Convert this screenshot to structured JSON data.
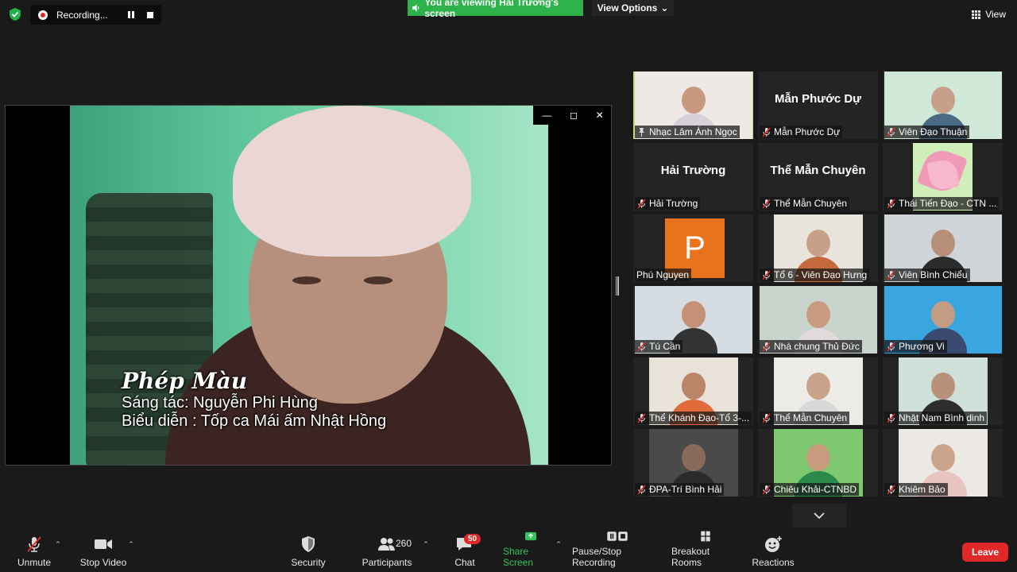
{
  "top": {
    "recording_label": "Recording...",
    "viewing_banner": "You are viewing Hải Trường's screen",
    "view_options": "View Options",
    "view_label": "View"
  },
  "video": {
    "caption_title": "Phép Màu",
    "caption_composer": "Sáng tác:   Nguyễn Phi Hùng",
    "caption_performer": "Biểu diễn : Tốp ca Mái ấm Nhật Hồng"
  },
  "participants": [
    {
      "label": "Nhạc Lâm Ánh Ngọc",
      "mode": "video",
      "active": true,
      "skin": "#c79a80",
      "shirt": "#d8d0d8",
      "bg": "#efe9e6",
      "pinned": true
    },
    {
      "label": "Mẫn Phước Dự",
      "mode": "name",
      "name": "Mẫn Phước Dự"
    },
    {
      "label": "Viên Đạo Thuận",
      "mode": "video",
      "skin": "#c7a08a",
      "shirt": "#4a6a86",
      "bg": "#cfe8d8"
    },
    {
      "label": "Hải Trường",
      "mode": "name",
      "name": "Hải Trường"
    },
    {
      "label": "Thể Mẫn Chuyên",
      "mode": "name",
      "name": "Thể Mẫn Chuyên"
    },
    {
      "label": "Thái Tiến Đạo - CTN ...",
      "mode": "flower"
    },
    {
      "label": "Phú Nguyen",
      "mode": "avatar",
      "letter": "P",
      "nomic": true
    },
    {
      "label": "Tổ 6  - Viên Đạo Hưng",
      "mode": "video",
      "skin": "#c8a08a",
      "shirt": "#c46a3c",
      "bg": "#e9e4dc"
    },
    {
      "label": "Viên Bình Chiểu",
      "mode": "video",
      "skin": "#b78e78",
      "shirt": "#2b2b2b",
      "bg": "#cfd4d8"
    },
    {
      "label": "Tú Cần",
      "mode": "video",
      "skin": "#c49076",
      "shirt": "#333333",
      "bg": "#d5dde3"
    },
    {
      "label": "Nhà chung Thủ Đức",
      "mode": "video",
      "skin": "#c89a82",
      "shirt": "#e0dada",
      "bg": "#c8d4cc"
    },
    {
      "label": "Phương Vi",
      "mode": "video",
      "skin": "#c49c84",
      "shirt": "#3a4a70",
      "bg": "#3aa6e0"
    },
    {
      "label": "Thể Khánh Đạo-Tổ 3-...",
      "mode": "video",
      "skin": "#b98468",
      "shirt": "#e06a3a",
      "bg": "#e8e2d8"
    },
    {
      "label": "Thể Mẫn Chuyên",
      "mode": "video",
      "skin": "#caa28a",
      "shirt": "#d8d8d8",
      "bg": "#ecebe6"
    },
    {
      "label": "Nhật Nam Bình dinh",
      "mode": "video",
      "skin": "#b9907a",
      "shirt": "#2e2e2e",
      "bg": "#cfe0d8"
    },
    {
      "label": "ĐPA-Trí Bình Hải",
      "mode": "video",
      "skin": "#8a6a5a",
      "shirt": "#2a2a2a",
      "bg": "#4a4a4a"
    },
    {
      "label": "Chiêu Khải-CTNBD",
      "mode": "video",
      "skin": "#c89a7e",
      "shirt": "#2a8a4a",
      "bg": "#7ec870"
    },
    {
      "label": "Khiêm Bảo",
      "mode": "video",
      "skin": "#cca48c",
      "shirt": "#e8c4c0",
      "bg": "#ece8e4"
    }
  ],
  "toolbar": {
    "unmute": "Unmute",
    "stop_video": "Stop Video",
    "security": "Security",
    "participants": "Participants",
    "participants_count": "260",
    "chat": "Chat",
    "chat_badge": "50",
    "share_screen": "Share Screen",
    "pause_stop": "Pause/Stop Recording",
    "breakout": "Breakout Rooms",
    "reactions": "Reactions",
    "leave": "Leave"
  },
  "colors": {
    "green": "#2db34a",
    "leave": "#e02828",
    "active_border": "#c6df6a",
    "avatar": "#e8731c"
  }
}
